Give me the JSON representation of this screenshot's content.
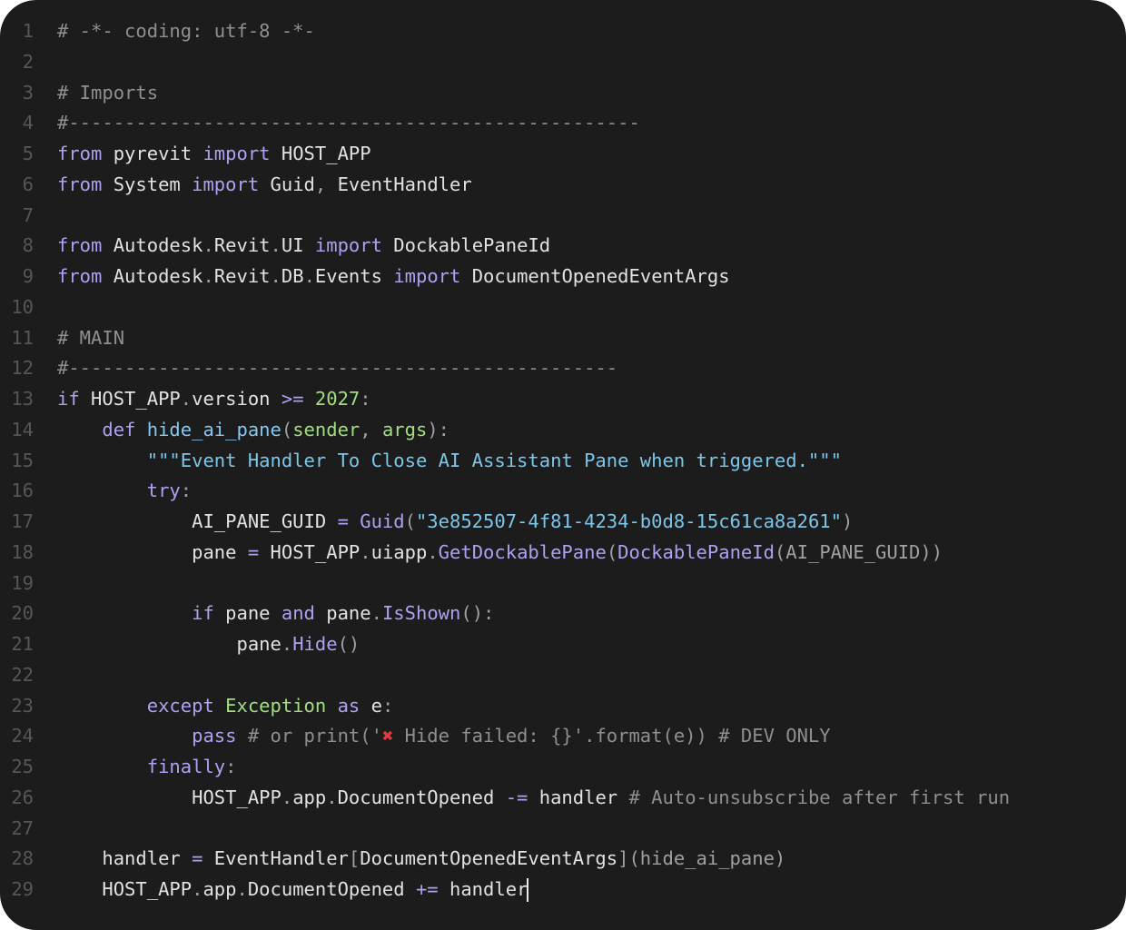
{
  "editor": {
    "language": "python",
    "caret_line": 29,
    "colors": {
      "background": "#1c1c1c",
      "line_number": "#565656",
      "text": "#e2e2e2",
      "keyword": "#b1a0f2",
      "comment": "#8f8f8f",
      "string": "#7cc6ea",
      "number": "#a2de80",
      "function": "#86c8f0"
    },
    "lines": [
      {
        "n": "1",
        "tokens": [
          {
            "t": "# -*- coding: utf-8 -*-",
            "k": "cm"
          }
        ]
      },
      {
        "n": "2",
        "tokens": []
      },
      {
        "n": "3",
        "tokens": [
          {
            "t": "# Imports",
            "k": "cm"
          }
        ]
      },
      {
        "n": "4",
        "tokens": [
          {
            "t": "#---------------------------------------------------",
            "k": "cm"
          }
        ]
      },
      {
        "n": "5",
        "tokens": [
          {
            "t": "from",
            "k": "kw"
          },
          {
            "t": " pyrevit "
          },
          {
            "t": "import",
            "k": "kw"
          },
          {
            "t": " HOST_APP"
          }
        ]
      },
      {
        "n": "6",
        "tokens": [
          {
            "t": "from",
            "k": "kw"
          },
          {
            "t": " System "
          },
          {
            "t": "import",
            "k": "kw"
          },
          {
            "t": " Guid"
          },
          {
            "t": ",",
            "k": "pn"
          },
          {
            "t": " EventHandler"
          }
        ]
      },
      {
        "n": "7",
        "tokens": []
      },
      {
        "n": "8",
        "tokens": [
          {
            "t": "from",
            "k": "kw"
          },
          {
            "t": " Autodesk"
          },
          {
            "t": ".",
            "k": "pn"
          },
          {
            "t": "Revit"
          },
          {
            "t": ".",
            "k": "pn"
          },
          {
            "t": "UI "
          },
          {
            "t": "import",
            "k": "kw"
          },
          {
            "t": " DockablePaneId"
          }
        ]
      },
      {
        "n": "9",
        "tokens": [
          {
            "t": "from",
            "k": "kw"
          },
          {
            "t": " Autodesk"
          },
          {
            "t": ".",
            "k": "pn"
          },
          {
            "t": "Revit"
          },
          {
            "t": ".",
            "k": "pn"
          },
          {
            "t": "DB"
          },
          {
            "t": ".",
            "k": "pn"
          },
          {
            "t": "Events "
          },
          {
            "t": "import",
            "k": "kw"
          },
          {
            "t": " DocumentOpenedEventArgs"
          }
        ]
      },
      {
        "n": "10",
        "tokens": []
      },
      {
        "n": "11",
        "tokens": [
          {
            "t": "# MAIN",
            "k": "cm"
          }
        ]
      },
      {
        "n": "12",
        "tokens": [
          {
            "t": "#-------------------------------------------------",
            "k": "cm"
          }
        ]
      },
      {
        "n": "13",
        "tokens": [
          {
            "t": "if",
            "k": "kw"
          },
          {
            "t": " HOST_APP"
          },
          {
            "t": ".",
            "k": "pn"
          },
          {
            "t": "version "
          },
          {
            "t": ">=",
            "k": "op"
          },
          {
            "t": " "
          },
          {
            "t": "2027",
            "k": "num"
          },
          {
            "t": ":",
            "k": "pn"
          }
        ]
      },
      {
        "n": "14",
        "tokens": [
          {
            "t": "    "
          },
          {
            "t": "def",
            "k": "kw"
          },
          {
            "t": " "
          },
          {
            "t": "hide_ai_pane",
            "k": "fn"
          },
          {
            "t": "(",
            "k": "pn"
          },
          {
            "t": "sender",
            "k": "pr"
          },
          {
            "t": ",",
            "k": "pn"
          },
          {
            "t": " "
          },
          {
            "t": "args",
            "k": "pr"
          },
          {
            "t": "):",
            "k": "pn"
          }
        ]
      },
      {
        "n": "15",
        "tokens": [
          {
            "t": "        "
          },
          {
            "t": "\"\"\"Event Handler To Close AI Assistant Pane when triggered.\"\"\"",
            "k": "st"
          }
        ]
      },
      {
        "n": "16",
        "tokens": [
          {
            "t": "        "
          },
          {
            "t": "try",
            "k": "kw"
          },
          {
            "t": ":",
            "k": "pn"
          }
        ]
      },
      {
        "n": "17",
        "tokens": [
          {
            "t": "            AI_PANE_GUID "
          },
          {
            "t": "=",
            "k": "op"
          },
          {
            "t": " "
          },
          {
            "t": "Guid",
            "k": "mt"
          },
          {
            "t": "(",
            "k": "pn"
          },
          {
            "t": "\"3e852507-4f81-4234-b0d8-15c61ca8a261\"",
            "k": "st"
          },
          {
            "t": ")",
            "k": "pn"
          }
        ]
      },
      {
        "n": "18",
        "tokens": [
          {
            "t": "            pane "
          },
          {
            "t": "=",
            "k": "op"
          },
          {
            "t": " HOST_APP"
          },
          {
            "t": ".",
            "k": "pn"
          },
          {
            "t": "uiapp"
          },
          {
            "t": ".",
            "k": "pn"
          },
          {
            "t": "GetDockablePane",
            "k": "mt"
          },
          {
            "t": "(",
            "k": "pn"
          },
          {
            "t": "DockablePaneId",
            "k": "mt"
          },
          {
            "t": "(AI_PANE_GUID))",
            "k": "pn"
          }
        ]
      },
      {
        "n": "19",
        "tokens": []
      },
      {
        "n": "20",
        "tokens": [
          {
            "t": "            "
          },
          {
            "t": "if",
            "k": "kw"
          },
          {
            "t": " pane "
          },
          {
            "t": "and",
            "k": "kw"
          },
          {
            "t": " pane"
          },
          {
            "t": ".",
            "k": "pn"
          },
          {
            "t": "IsShown",
            "k": "mt"
          },
          {
            "t": "():",
            "k": "pn"
          }
        ]
      },
      {
        "n": "21",
        "tokens": [
          {
            "t": "                pane"
          },
          {
            "t": ".",
            "k": "pn"
          },
          {
            "t": "Hide",
            "k": "mt"
          },
          {
            "t": "()",
            "k": "pn"
          }
        ]
      },
      {
        "n": "22",
        "tokens": []
      },
      {
        "n": "23",
        "tokens": [
          {
            "t": "        "
          },
          {
            "t": "except",
            "k": "kw"
          },
          {
            "t": " "
          },
          {
            "t": "Exception",
            "k": "cls"
          },
          {
            "t": " "
          },
          {
            "t": "as",
            "k": "kw"
          },
          {
            "t": " e"
          },
          {
            "t": ":",
            "k": "pn"
          }
        ]
      },
      {
        "n": "24",
        "tokens": [
          {
            "t": "            "
          },
          {
            "t": "pass",
            "k": "kw"
          },
          {
            "t": " # or print('",
            "k": "cm"
          },
          {
            "t": "✖",
            "k": "emoji"
          },
          {
            "t": " Hide failed: {}'.format(e)) # DEV ONLY",
            "k": "cm"
          }
        ]
      },
      {
        "n": "25",
        "tokens": [
          {
            "t": "        "
          },
          {
            "t": "finally",
            "k": "kw"
          },
          {
            "t": ":",
            "k": "pn"
          }
        ]
      },
      {
        "n": "26",
        "tokens": [
          {
            "t": "            HOST_APP"
          },
          {
            "t": ".",
            "k": "pn"
          },
          {
            "t": "app"
          },
          {
            "t": ".",
            "k": "pn"
          },
          {
            "t": "DocumentOpened "
          },
          {
            "t": "-=",
            "k": "op"
          },
          {
            "t": " handler "
          },
          {
            "t": "# Auto-unsubscribe after first run",
            "k": "cm"
          }
        ]
      },
      {
        "n": "27",
        "tokens": []
      },
      {
        "n": "28",
        "tokens": [
          {
            "t": "    handler "
          },
          {
            "t": "=",
            "k": "op"
          },
          {
            "t": " EventHandler"
          },
          {
            "t": "[",
            "k": "pn"
          },
          {
            "t": "DocumentOpenedEventArgs"
          },
          {
            "t": "](hide_ai_pane)",
            "k": "pn"
          }
        ]
      },
      {
        "n": "29",
        "tokens": [
          {
            "t": "    HOST_APP"
          },
          {
            "t": ".",
            "k": "pn"
          },
          {
            "t": "app"
          },
          {
            "t": ".",
            "k": "pn"
          },
          {
            "t": "DocumentOpened "
          },
          {
            "t": "+=",
            "k": "op"
          },
          {
            "t": " handler"
          }
        ]
      }
    ]
  }
}
